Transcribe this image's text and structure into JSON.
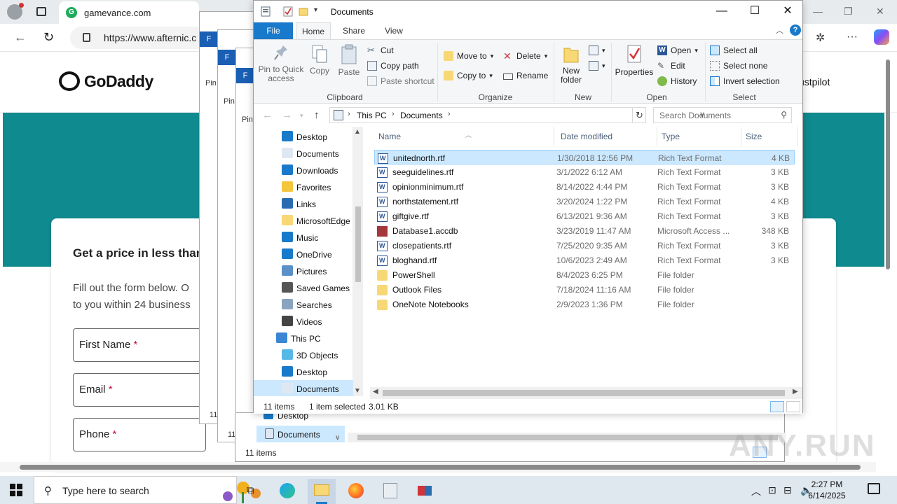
{
  "browser": {
    "tab_title": "gamevance.com",
    "url": "https://www.afternic.c",
    "brand": "GoDaddy",
    "trustpilot": "ustpilot",
    "card_title": "Get a price in less than",
    "card_desc": "Fill out the form below. O\nto you within 24 business",
    "fields": [
      {
        "label": "First Name",
        "required": "*"
      },
      {
        "label": "Email",
        "required": "*"
      },
      {
        "label": "Phone",
        "required": "*"
      }
    ]
  },
  "ghosts": {
    "file_tab": "F",
    "pin_text": "Pin",
    "items_text": "11",
    "short_a": "a"
  },
  "explorer": {
    "title": "Documents",
    "tabs": {
      "file": "File",
      "home": "Home",
      "share": "Share",
      "view": "View"
    },
    "ribbon": {
      "clipboard": {
        "label": "Clipboard",
        "pin": "Pin to Quick access",
        "copy": "Copy",
        "paste": "Paste",
        "cut": "Cut",
        "copy_path": "Copy path",
        "paste_shortcut": "Paste shortcut"
      },
      "organize": {
        "label": "Organize",
        "move_to": "Move to",
        "copy_to": "Copy to",
        "delete": "Delete",
        "rename": "Rename"
      },
      "new": {
        "label": "New",
        "new_folder": "New folder"
      },
      "open": {
        "label": "Open",
        "properties": "Properties",
        "open": "Open",
        "edit": "Edit",
        "history": "History"
      },
      "select": {
        "label": "Select",
        "select_all": "Select all",
        "select_none": "Select none",
        "invert": "Invert selection"
      }
    },
    "address": {
      "parts": [
        "This PC",
        "Documents"
      ]
    },
    "search_placeholder": "Search Documents",
    "nav_items": [
      {
        "label": "Desktop",
        "icon": "desktop-icon",
        "color": "#1979ca",
        "indent": 1
      },
      {
        "label": "Documents",
        "icon": "documents-icon",
        "color": "#dfe8f2",
        "indent": 1
      },
      {
        "label": "Downloads",
        "icon": "downloads-icon",
        "color": "#1979ca",
        "indent": 1
      },
      {
        "label": "Favorites",
        "icon": "favorites-icon",
        "color": "#f3c63c",
        "indent": 1
      },
      {
        "label": "Links",
        "icon": "links-icon",
        "color": "#2b6cb0",
        "indent": 1
      },
      {
        "label": "MicrosoftEdge",
        "icon": "folder-icon",
        "color": "#f8d775",
        "indent": 1
      },
      {
        "label": "Music",
        "icon": "music-icon",
        "color": "#1979ca",
        "indent": 1
      },
      {
        "label": "OneDrive",
        "icon": "onedrive-icon",
        "color": "#1979ca",
        "indent": 1
      },
      {
        "label": "Pictures",
        "icon": "pictures-icon",
        "color": "#5a8fc7",
        "indent": 1
      },
      {
        "label": "Saved Games",
        "icon": "saved-games-icon",
        "color": "#555555",
        "indent": 1
      },
      {
        "label": "Searches",
        "icon": "searches-icon",
        "color": "#8aa4c0",
        "indent": 1
      },
      {
        "label": "Videos",
        "icon": "videos-icon",
        "color": "#444444",
        "indent": 1
      },
      {
        "label": "This PC",
        "icon": "this-pc-icon",
        "color": "#3a86d4",
        "indent": 0
      },
      {
        "label": "3D Objects",
        "icon": "3d-objects-icon",
        "color": "#55b8e6",
        "indent": 1
      },
      {
        "label": "Desktop",
        "icon": "desktop-icon",
        "color": "#1979ca",
        "indent": 1
      },
      {
        "label": "Documents",
        "icon": "documents-icon",
        "color": "#dfe8f2",
        "indent": 1
      }
    ],
    "columns": {
      "name": "Name",
      "date": "Date modified",
      "type": "Type",
      "size": "Size"
    },
    "files": [
      {
        "name": "unitednorth.rtf",
        "date": "1/30/2018 12:56 PM",
        "type": "Rich Text Format",
        "size": "4 KB",
        "kind": "rtf",
        "selected": true
      },
      {
        "name": "seeguidelines.rtf",
        "date": "3/1/2022 6:12 AM",
        "type": "Rich Text Format",
        "size": "3 KB",
        "kind": "rtf"
      },
      {
        "name": "opinionminimum.rtf",
        "date": "8/14/2022 4:44 PM",
        "type": "Rich Text Format",
        "size": "3 KB",
        "kind": "rtf"
      },
      {
        "name": "northstatement.rtf",
        "date": "3/20/2024 1:22 PM",
        "type": "Rich Text Format",
        "size": "4 KB",
        "kind": "rtf"
      },
      {
        "name": "giftgive.rtf",
        "date": "6/13/2021 9:36 AM",
        "type": "Rich Text Format",
        "size": "3 KB",
        "kind": "rtf"
      },
      {
        "name": "Database1.accdb",
        "date": "3/23/2019 11:47 AM",
        "type": "Microsoft Access ...",
        "size": "348 KB",
        "kind": "accdb"
      },
      {
        "name": "closepatients.rtf",
        "date": "7/25/2020 9:35 AM",
        "type": "Rich Text Format",
        "size": "3 KB",
        "kind": "rtf"
      },
      {
        "name": "bloghand.rtf",
        "date": "10/6/2023 2:49 AM",
        "type": "Rich Text Format",
        "size": "3 KB",
        "kind": "rtf"
      },
      {
        "name": "PowerShell",
        "date": "8/4/2023 6:25 PM",
        "type": "File folder",
        "size": "",
        "kind": "folder"
      },
      {
        "name": "Outlook Files",
        "date": "7/18/2024 11:16 AM",
        "type": "File folder",
        "size": "",
        "kind": "folder"
      },
      {
        "name": "OneNote Notebooks",
        "date": "2/9/2023 1:36 PM",
        "type": "File folder",
        "size": "",
        "kind": "folder"
      }
    ],
    "status": {
      "count": "11 items",
      "selected": "1 item selected",
      "size": "3.01 KB"
    }
  },
  "explorer2": {
    "nav_items": [
      {
        "label": "Desktop"
      },
      {
        "label": "Documents"
      }
    ],
    "status": "11 items"
  },
  "watermark": "ANY.RUN",
  "taskbar": {
    "search_placeholder": "Type here to search",
    "time": "2:27 PM",
    "date": "6/14/2025"
  }
}
